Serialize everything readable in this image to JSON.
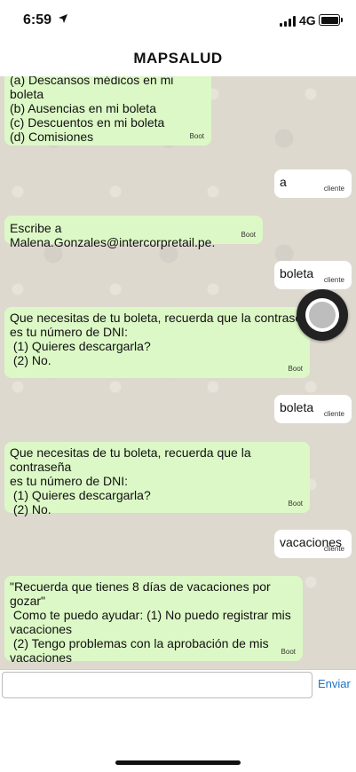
{
  "status_bar": {
    "time": "6:59",
    "network": "4G"
  },
  "header": {
    "title": "MAPSALUD"
  },
  "messages": [
    {
      "from": "bot",
      "text": "(a) Descansos médicos en mi boleta\n(b) Ausencias en mi boleta\n(c) Descuentos en mi boleta\n(d) Comisiones",
      "sender_label": "Boot"
    },
    {
      "from": "user",
      "text": "a",
      "sender_label": "cliente"
    },
    {
      "from": "bot",
      "text": "Escribe a Malena.Gonzales@intercorpretail.pe.",
      "sender_label": "Boot"
    },
    {
      "from": "user",
      "text": "boleta",
      "sender_label": "cliente"
    },
    {
      "from": "bot",
      "text": "Que necesitas de tu boleta, recuerda que la contraseña\nes tu número de DNI:\n (1) Quieres descargarla?\n (2) No.",
      "sender_label": "Boot"
    },
    {
      "from": "user",
      "text": "boleta",
      "sender_label": "cliente"
    },
    {
      "from": "bot",
      "text": "Que necesitas de tu boleta, recuerda que la contraseña\nes tu número de DNI:\n (1) Quieres descargarla?\n (2) No.",
      "sender_label": "Boot"
    },
    {
      "from": "user",
      "text": "vacaciones",
      "sender_label": "cliente"
    },
    {
      "from": "bot",
      "text": "\"Recuerda que tienes 8 días de vacaciones por gozar\"\n Como te puedo ayudar: (1) No puedo registrar mis\nvacaciones\n (2) Tengo problemas con la aprobación de mis\nvacaciones",
      "sender_label": "Boot"
    }
  ],
  "input": {
    "value": "",
    "placeholder": ""
  },
  "send_button": {
    "label": "Enviar"
  },
  "colors": {
    "bot_bubble": "#dcf8c6",
    "user_bubble": "#ffffff",
    "chat_background": "#ded9cf",
    "send_link": "#1a73c8"
  },
  "icons": {
    "status": [
      "location-arrow-icon",
      "signal-icon",
      "battery-icon"
    ],
    "floating": "camera-capture-icon"
  }
}
